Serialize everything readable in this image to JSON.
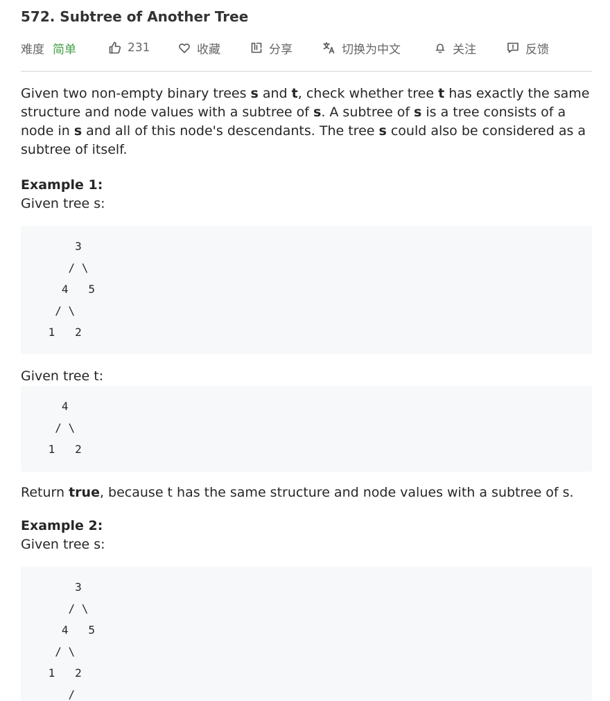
{
  "problem": {
    "title": "572. Subtree of Another Tree"
  },
  "toolbar": {
    "difficulty_label": "难度",
    "difficulty_value": "简单",
    "difficulty_color": "#43a047",
    "likes": "231",
    "favorite_label": "收藏",
    "share_label": "分享",
    "language_toggle_label": "切换为中文",
    "follow_label": "关注",
    "feedback_label": "反馈",
    "icons": [
      "thumbs-up-icon",
      "heart-icon",
      "share-icon",
      "translate-icon",
      "bell-icon",
      "feedback-icon"
    ]
  },
  "description": {
    "s1": "Given two non-empty binary trees ",
    "b1": "s",
    "s2": " and ",
    "b2": "t",
    "s3": ", check whether tree ",
    "b3": "t",
    "s4": " has exactly the same structure and node values with a subtree of ",
    "b4": "s",
    "s5": ". A subtree of ",
    "b5": "s",
    "s6": " is a tree consists of a node in ",
    "b6": "s",
    "s7": " and all of this node's descendants. The tree ",
    "b7": "s",
    "s8": " could also be considered as a subtree of itself."
  },
  "example1": {
    "heading": "Example 1:",
    "given_s": "Given tree s:",
    "tree_s": "     3\n    / \\\n   4   5\n  / \\\n 1   2",
    "given_t": "Given tree t:",
    "tree_t": "   4\n  / \\\n 1   2",
    "return_pre": "Return ",
    "return_value": "true",
    "return_post": ", because t has the same structure and node values with a subtree of s."
  },
  "example2": {
    "heading": "Example 2:",
    "given_s": "Given tree s:",
    "tree_s": "     3\n    / \\\n   4   5\n  / \\\n 1   2\n    /"
  }
}
